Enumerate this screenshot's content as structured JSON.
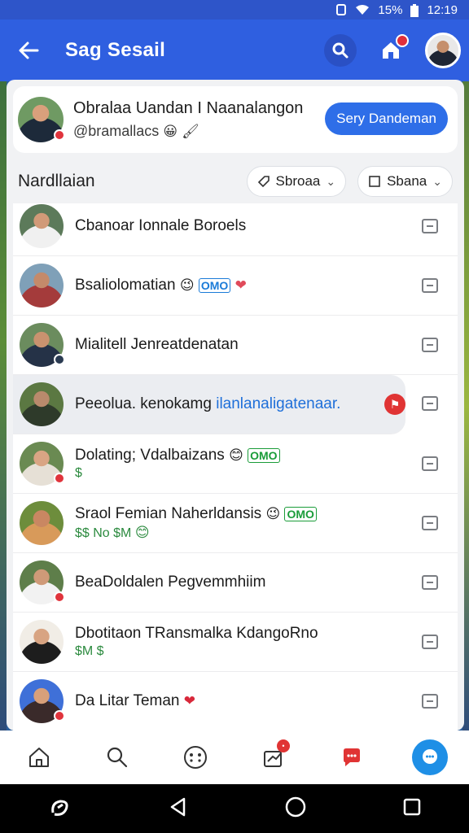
{
  "status_bar": {
    "battery": "15%",
    "time": "12:19"
  },
  "app_bar": {
    "title": "Sag Sesail"
  },
  "profile": {
    "name": "Obralaa Uandan I Naanalangon",
    "handle": "@bramallacs",
    "button_label": "Sery Dandeman"
  },
  "section": {
    "title": "Nardllaian",
    "filter1": "Sbroaa",
    "filter2": "Sbana"
  },
  "contacts": [
    {
      "name": "Cbanoar Ionnale Boroels",
      "extra": "",
      "sub": ""
    },
    {
      "name": "Bsaliolomatian",
      "extra": "OMO",
      "sub": ""
    },
    {
      "name": "Mialitell Jenreatdenatan",
      "extra": "",
      "sub": ""
    },
    {
      "name": "Peeolua. kenokamg",
      "extra": "ilanlanaligatenaar.",
      "sub": ""
    },
    {
      "name": "Dolating; Vdalbaizans",
      "extra": "OMO",
      "sub": "$"
    },
    {
      "name": "Sraol Femian Naherldansis",
      "extra": "OMO",
      "sub": "$$ No $M"
    },
    {
      "name": "BeaDoldalen Pegvemmhiim",
      "extra": "",
      "sub": ""
    },
    {
      "name": "Dbotitaon TRansmalka KdangoRno",
      "extra": "",
      "sub": "$M $"
    },
    {
      "name": "Da Litar Teman",
      "extra": "",
      "sub": ""
    }
  ],
  "colors": {
    "app_bar": "#2f5fe0",
    "accent": "#2e6ee8",
    "badge": "#e03434"
  },
  "icons": {
    "back": "arrow-left-icon",
    "search": "search-icon",
    "home": "home-icon",
    "nav": [
      "home-icon",
      "search-icon",
      "emoji-icon",
      "notification-icon",
      "alert-icon",
      "chat-icon"
    ],
    "system": [
      "assistant-icon",
      "back-triangle-icon",
      "home-circle-icon",
      "recents-square-icon"
    ]
  }
}
